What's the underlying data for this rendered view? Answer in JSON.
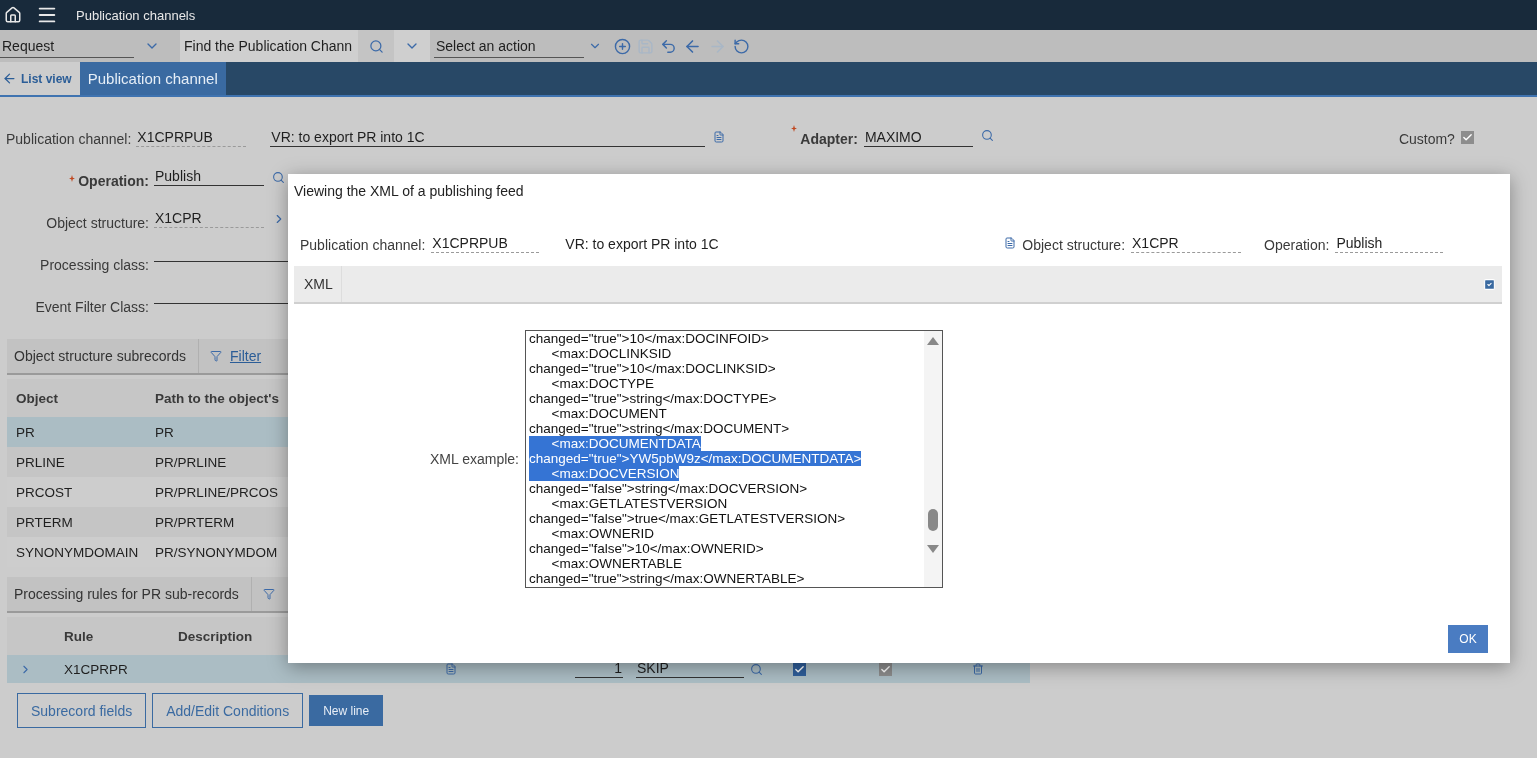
{
  "top_bar": {
    "title": "Publication channels"
  },
  "toolbar": {
    "view_select": "Request",
    "search": {
      "placeholder": "Find the Publication Chann"
    },
    "action_select": "Select an action",
    "buttons": [
      {
        "kind": "add",
        "disabled": false
      },
      {
        "kind": "save",
        "disabled": true
      },
      {
        "kind": "undo",
        "disabled": false
      },
      {
        "kind": "back",
        "disabled": false
      },
      {
        "kind": "forward",
        "disabled": true
      },
      {
        "kind": "refresh",
        "disabled": false
      }
    ]
  },
  "tabs": [
    {
      "label": "List view",
      "kind": "back",
      "selected": false
    },
    {
      "label": "Publication channel",
      "kind": "tab",
      "selected": true
    }
  ],
  "header": {
    "channel_label": "Publication channel:",
    "channel": "X1CPRPUB",
    "description": "VR: to export PR into 1C",
    "adapter_label": "Adapter:",
    "adapter": "MAXIMO",
    "custom": {
      "label": "Custom?",
      "checked": true
    }
  },
  "fields": [
    {
      "label": "Operation:",
      "value": "Publish",
      "required": true,
      "kind": "lookup"
    },
    {
      "label": "Object structure:",
      "value": "X1CPR",
      "required": false,
      "kind": "link"
    },
    {
      "label": "Processing class:",
      "required": false,
      "kind": "input"
    },
    {
      "label": "Event Filter Class:",
      "required": false,
      "kind": "input"
    }
  ],
  "subrecords": {
    "title": "Object structure subrecords",
    "filter": "Filter",
    "columns": [
      "Object",
      "Path to the object's"
    ],
    "rows": [
      {
        "cells": [
          "PR",
          "PR"
        ],
        "selected": true
      },
      {
        "cells": [
          "PRLINE",
          "PR/PRLINE"
        ],
        "selected": false
      },
      {
        "cells": [
          "PRCOST",
          "PR/PRLINE/PRCOS"
        ],
        "selected": false
      },
      {
        "cells": [
          "PRTERM",
          "PR/PRTERM"
        ],
        "selected": false
      },
      {
        "cells": [
          "SYNONYMDOMAIN",
          "PR/SYNONYMDOM"
        ],
        "selected": false
      }
    ]
  },
  "rules": {
    "title": "Processing rules for PR sub-records",
    "columns": [
      "Rule",
      "Description"
    ],
    "rows": [
      {
        "rule": "X1CPRPR",
        "sequence": "1",
        "action": "SKIP",
        "selected": true,
        "checkboxes": [
          {
            "checked": true,
            "disabled": false
          },
          {
            "checked": true,
            "disabled": true
          }
        ]
      }
    ]
  },
  "buttons": [
    {
      "label": "Subrecord fields",
      "kind": "secondary"
    },
    {
      "label": "Add/Edit Conditions",
      "kind": "secondary"
    },
    {
      "label": "New line",
      "kind": "primary"
    }
  ],
  "dialog": {
    "title": "Viewing the XML of a publishing feed",
    "channel_label": "Publication channel:",
    "channel": "X1CPRPUB",
    "description": "VR: to export PR into 1C",
    "structure_label": "Object structure:",
    "structure": "X1CPR",
    "operation_label": "Operation:",
    "operation": "Publish",
    "section": "XML",
    "xml_label": "XML example:",
    "lines": [
      {
        "text": "changed=\"true\">10</max:DOCINFOID>",
        "selected": false
      },
      {
        "text": "      <max:DOCLINKSID",
        "selected": false
      },
      {
        "text": "changed=\"true\">10</max:DOCLINKSID>",
        "selected": false
      },
      {
        "text": "      <max:DOCTYPE",
        "selected": false
      },
      {
        "text": "changed=\"true\">string</max:DOCTYPE>",
        "selected": false
      },
      {
        "text": "      <max:DOCUMENT",
        "selected": false
      },
      {
        "text": "changed=\"true\">string</max:DOCUMENT>",
        "selected": false
      },
      {
        "text": "      <max:DOCUMENTDATA",
        "selected": true
      },
      {
        "text": "changed=\"true\">YW5pbW9z</max:DOCUMENTDATA>",
        "selected": true
      },
      {
        "text": "      <max:DOCVERSION",
        "selected": true
      },
      {
        "text": "changed=\"false\">string</max:DOCVERSION>",
        "selected": false
      },
      {
        "text": "      <max:GETLATESTVERSION",
        "selected": false
      },
      {
        "text": "changed=\"false\">true</max:GETLATESTVERSION>",
        "selected": false
      },
      {
        "text": "      <max:OWNERID",
        "selected": false
      },
      {
        "text": "changed=\"false\">10</max:OWNERID>",
        "selected": false
      },
      {
        "text": "      <max:OWNERTABLE",
        "selected": false
      },
      {
        "text": "changed=\"true\">string</max:OWNERTABLE>",
        "selected": false
      }
    ],
    "ok": "OK"
  }
}
